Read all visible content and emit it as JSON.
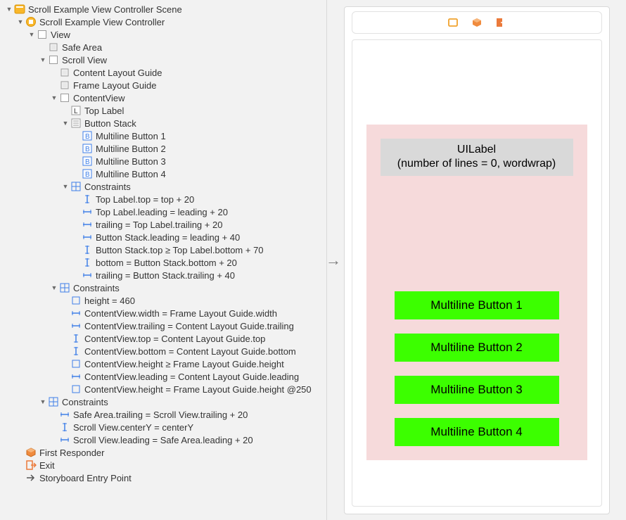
{
  "tree": {
    "i0": "Scroll Example View Controller Scene",
    "i1": "Scroll Example View Controller",
    "i2": "View",
    "i3": "Safe Area",
    "i4": "Scroll View",
    "i5": "Content Layout Guide",
    "i6": "Frame Layout Guide",
    "i7": "ContentView",
    "i8": "Top Label",
    "i9": "Button Stack",
    "i10": "Multiline Button 1",
    "i11": "Multiline Button 2",
    "i12": "Multiline Button 3",
    "i13": "Multiline Button 4",
    "i14": "Constraints",
    "i15": "Top Label.top = top + 20",
    "i16": "Top Label.leading = leading + 20",
    "i17": "trailing = Top Label.trailing + 20",
    "i18": "Button Stack.leading = leading + 40",
    "i19": "Button Stack.top ≥ Top Label.bottom + 70",
    "i20": "bottom = Button Stack.bottom + 20",
    "i21": "trailing = Button Stack.trailing + 40",
    "i22": "Constraints",
    "i23": "height = 460",
    "i24": "ContentView.width = Frame Layout Guide.width",
    "i25": "ContentView.trailing = Content Layout Guide.trailing",
    "i26": "ContentView.top = Content Layout Guide.top",
    "i27": "ContentView.bottom = Content Layout Guide.bottom",
    "i28": "ContentView.height ≥ Frame Layout Guide.height",
    "i29": "ContentView.leading = Content Layout Guide.leading",
    "i30": "ContentView.height = Frame Layout Guide.height @250",
    "i31": "Constraints",
    "i32": "Safe Area.trailing = Scroll View.trailing + 20",
    "i33": "Scroll View.centerY = centerY",
    "i34": "Scroll View.leading = Safe Area.leading + 20",
    "i35": "First Responder",
    "i36": "Exit",
    "i37": "Storyboard Entry Point"
  },
  "preview": {
    "label_line1": "UILabel",
    "label_line2": "(number of lines = 0, wordwrap)",
    "buttons": {
      "b1": "Multiline Button 1",
      "b2": "Multiline Button 2",
      "b3": "Multiline Button 3",
      "b4": "Multiline Button 4"
    }
  }
}
